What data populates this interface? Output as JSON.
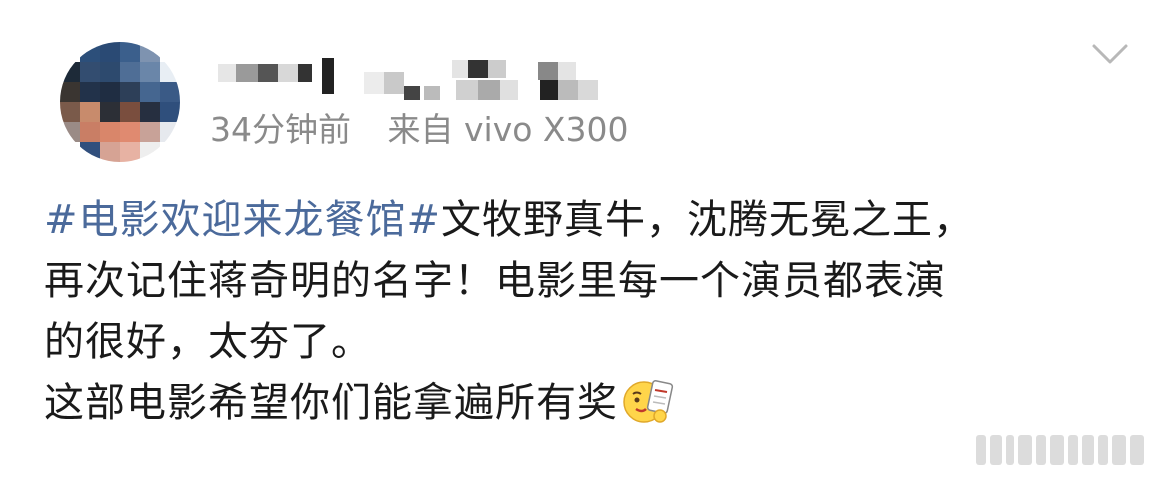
{
  "post": {
    "meta": {
      "time": "34分钟前",
      "source": "来自 vivo X300"
    },
    "content": {
      "line1_topic": "#电影欢迎来龙餐馆#",
      "line1_rest": "文牧野真牛，沈腾无冕之王，",
      "line2": "再次记住蒋奇明的名字！电影里每一个演员都表演",
      "line3": "的很好，太夯了。",
      "line4": "这部电影希望你们能拿遍所有奖"
    },
    "icons": {
      "expand": "chevron-down-icon",
      "emoji": "ticket-emoji-icon"
    },
    "colors": {
      "topic": "#4b6a9b",
      "meta": "#8a8a8a",
      "text": "#1a1a1a"
    }
  }
}
